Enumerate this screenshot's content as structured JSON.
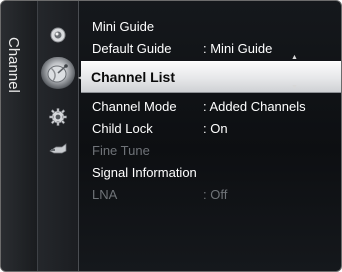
{
  "panel": {
    "title": "Channel"
  },
  "menu": {
    "items": [
      {
        "label": "Mini Guide",
        "value": ""
      },
      {
        "label": "Default Guide",
        "value": ": Mini Guide"
      },
      {
        "label": "Channel List",
        "value": ""
      },
      {
        "label": "Channel Mode",
        "value": ": Added Channels"
      },
      {
        "label": "Child Lock",
        "value": ": On"
      },
      {
        "label": "Fine Tune",
        "value": ""
      },
      {
        "label": "Signal Information",
        "value": ""
      },
      {
        "label": "LNA",
        "value": ": Off"
      }
    ]
  },
  "icons": [
    "picture-icon",
    "channel-dish-icon",
    "settings-gear-icon",
    "input-icon"
  ],
  "colors": {
    "background": "#101215",
    "selected_bg": "#e6e7e9",
    "text": "#ffffff",
    "disabled_text": "#6f7378"
  }
}
